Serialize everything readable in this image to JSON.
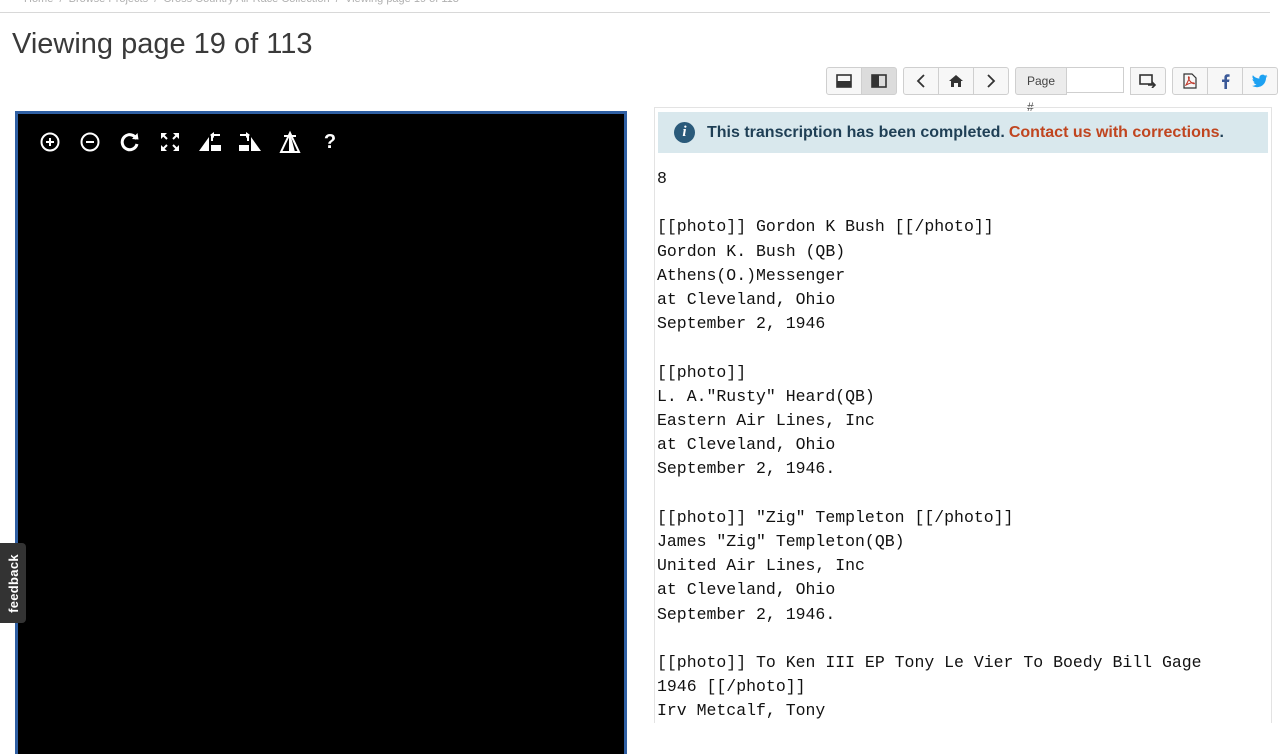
{
  "title": "Viewing page 19 of 113",
  "toolbar": {
    "layout_buttons": [
      "layout-stacked",
      "layout-side-by-side"
    ],
    "page_label": "Page #",
    "page_value": ""
  },
  "viewer": {
    "tools": [
      "zoom-in",
      "zoom-out",
      "rotate",
      "fullscreen",
      "rotate-left",
      "rotate-right",
      "adjust",
      "help"
    ],
    "help_label": "?"
  },
  "feedback_label": "feedback",
  "notice": {
    "text": "This transcription has been completed.",
    "link": "Contact us with corrections",
    "suffix": "."
  },
  "transcription": "8\n\n[[photo]] Gordon K Bush [[/photo]]\nGordon K. Bush (QB)\nAthens(O.)Messenger\nat Cleveland, Ohio\nSeptember 2, 1946\n\n[[photo]]\nL. A.\"Rusty\" Heard(QB)\nEastern Air Lines, Inc\nat Cleveland, Ohio\nSeptember 2, 1946.\n\n[[photo]] \"Zig\" Templeton [[/photo]]\nJames \"Zig\" Templeton(QB)\nUnited Air Lines, Inc\nat Cleveland, Ohio\nSeptember 2, 1946.\n\n[[photo]] To Ken III EP Tony Le Vier To Boedy Bill Gage\n1946 [[/photo]]\nIrv Metcalf, Tony"
}
